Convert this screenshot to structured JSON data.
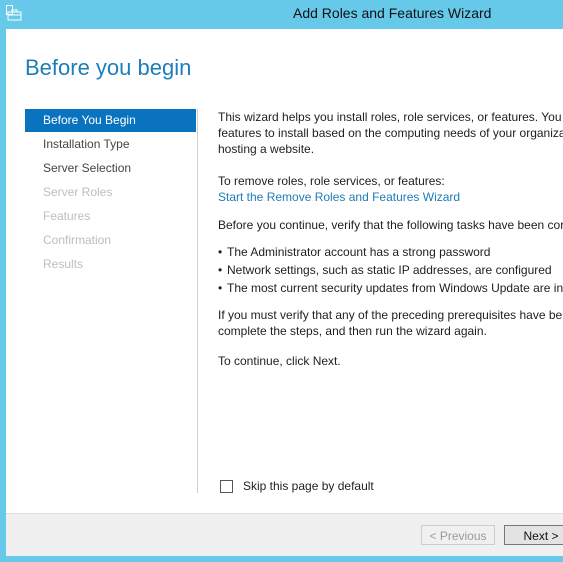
{
  "window": {
    "title": "Add Roles and Features Wizard",
    "icon": "server-manager-icon"
  },
  "page_title": "Before you begin",
  "nav": {
    "items": [
      {
        "label": "Before You Begin",
        "state": "active"
      },
      {
        "label": "Installation Type",
        "state": "enabled"
      },
      {
        "label": "Server Selection",
        "state": "enabled"
      },
      {
        "label": "Server Roles",
        "state": "disabled"
      },
      {
        "label": "Features",
        "state": "disabled"
      },
      {
        "label": "Confirmation",
        "state": "disabled"
      },
      {
        "label": "Results",
        "state": "disabled"
      }
    ]
  },
  "content": {
    "intro": [
      "This wizard helps you install roles, role services, or features. You d",
      "features to install based on the computing needs of your organiza",
      "hosting a website."
    ],
    "remove_label": "To remove roles, role services, or features:",
    "remove_link": "Start the Remove Roles and Features Wizard",
    "verify": "Before you continue, verify that the following tasks have been cor",
    "bullets": [
      "The Administrator account has a strong password",
      "Network settings, such as static IP addresses, are configured",
      "The most current security updates from Windows Update are in"
    ],
    "prereq": [
      "If you must verify that any of the preceding prerequisites have be",
      "complete the steps, and then run the wizard again."
    ],
    "continue": "To continue, click Next."
  },
  "skip_checkbox": {
    "label": "Skip this page by default",
    "checked": false
  },
  "footer": {
    "previous_label": "< Previous",
    "next_label": "Next >"
  },
  "colors": {
    "titlebar": "#66c9ea",
    "accent": "#0a73c0",
    "link": "#1c7db5"
  }
}
